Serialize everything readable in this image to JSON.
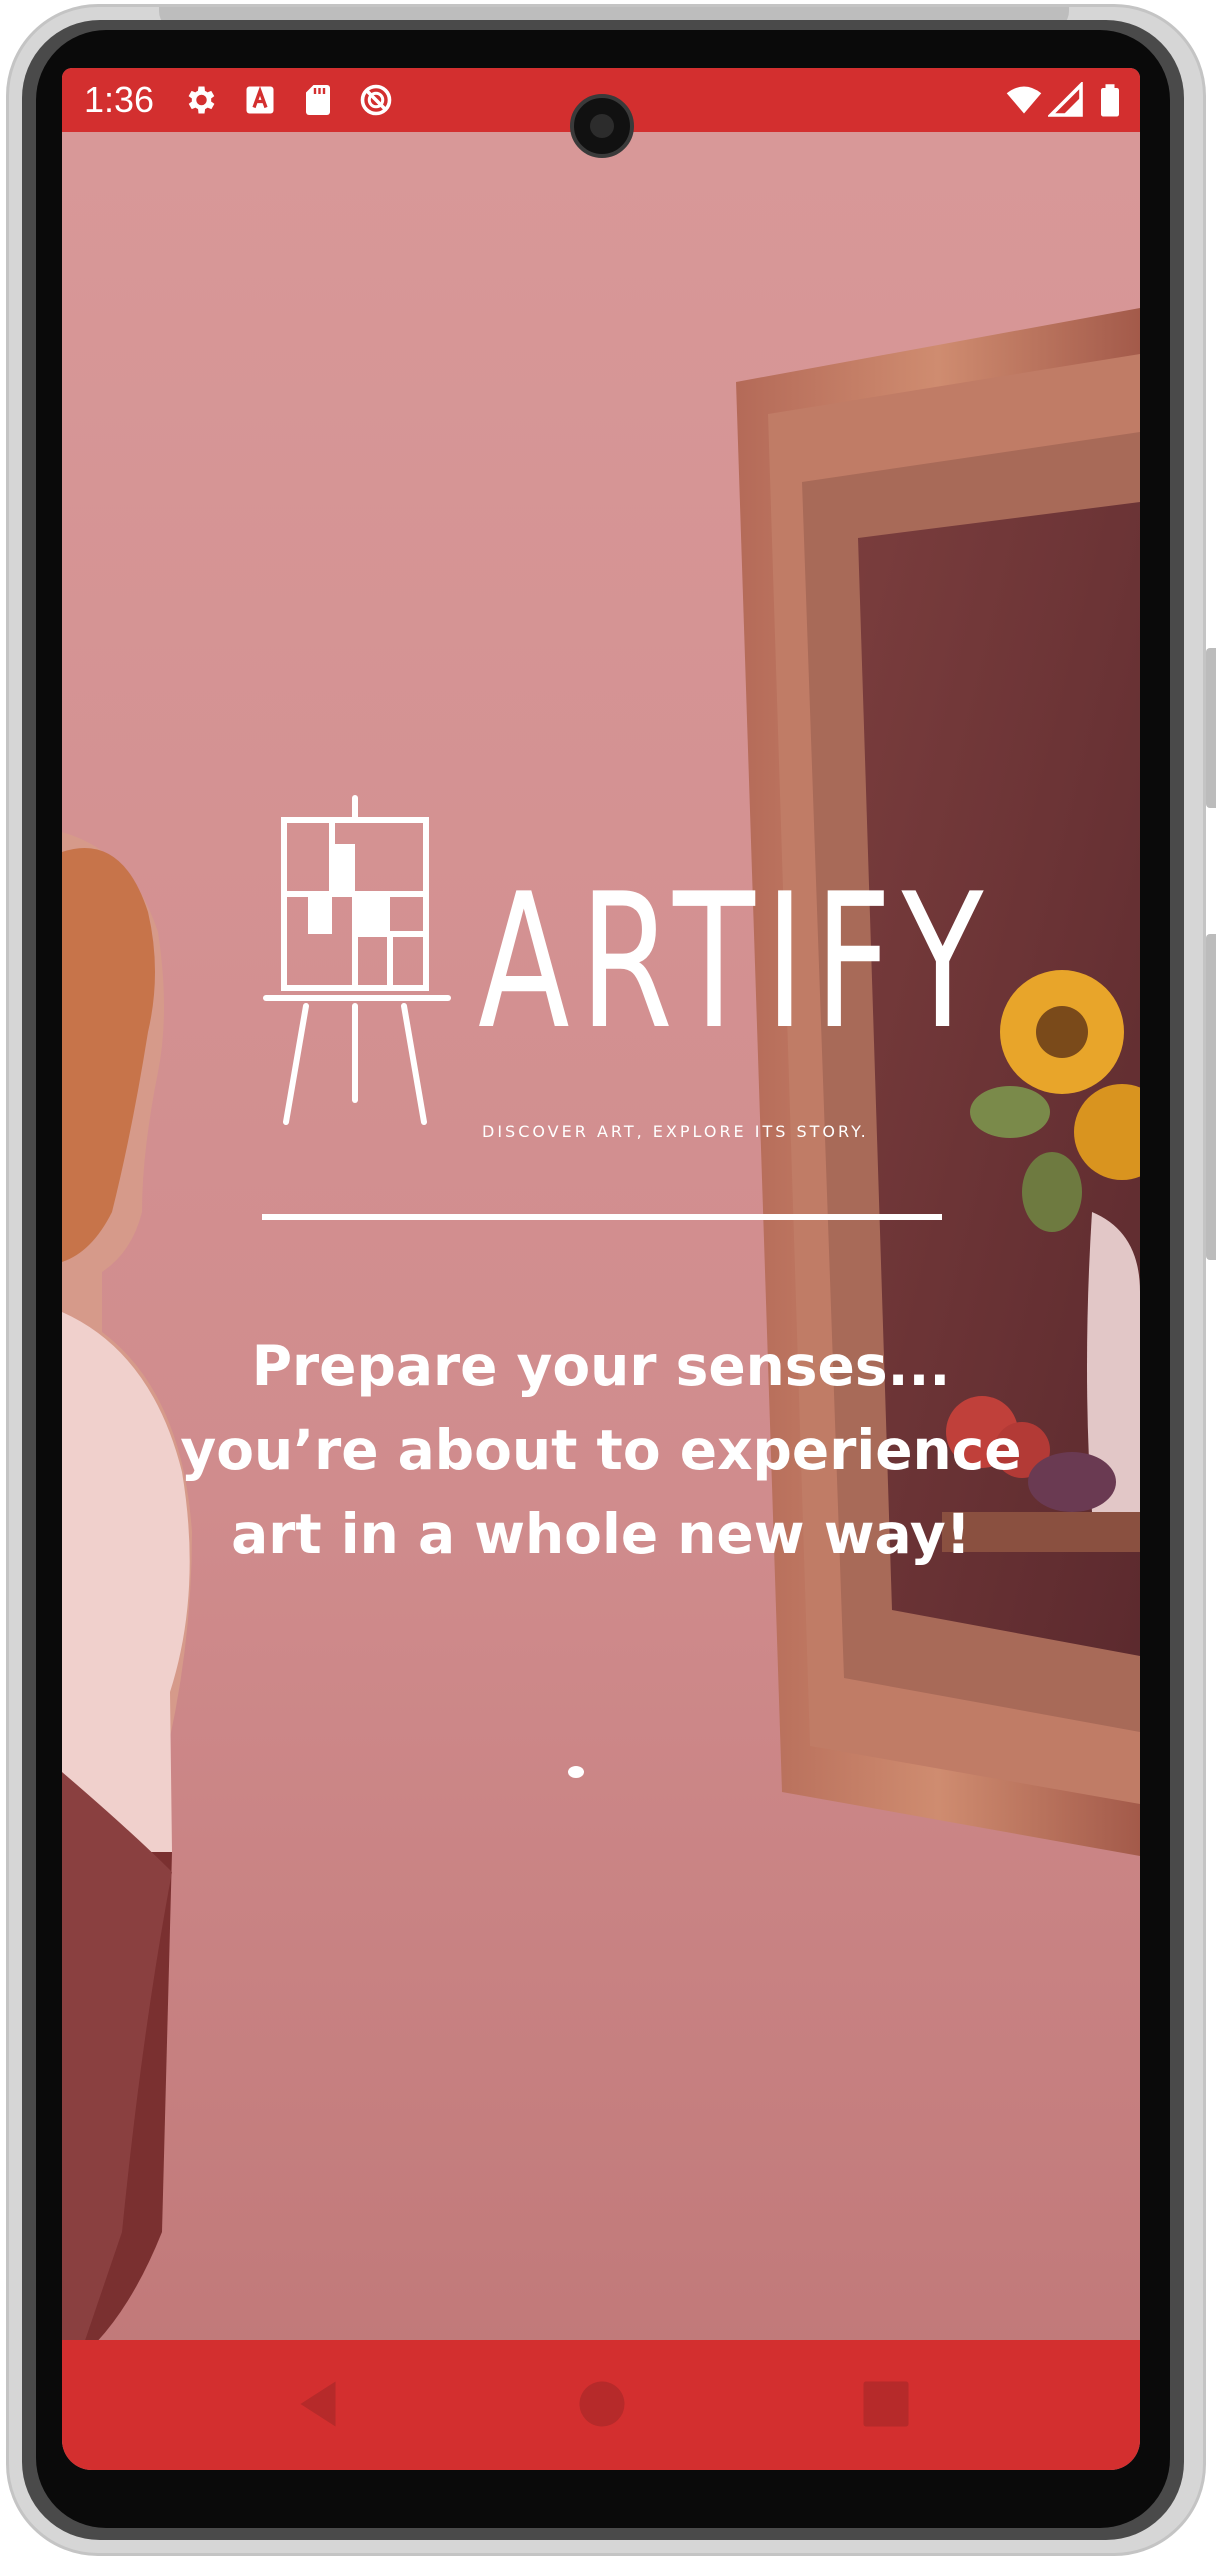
{
  "status_bar": {
    "time": "1:36",
    "left_icons": [
      "gear-icon",
      "a-letter-icon",
      "sd-card-icon",
      "do-not-disturb-icon"
    ],
    "right_icons": [
      "wifi-icon",
      "cell-signal-icon",
      "battery-icon"
    ],
    "background_color": "#d32f2f"
  },
  "splash": {
    "brand_name": "ARTIFY",
    "tagline": "DISCOVER ART, EXPLORE ITS STORY.",
    "headline_lines": [
      "Prepare your senses...",
      "you’re about to experience",
      "art in a whole new way!"
    ],
    "overlay_color": "#d32f2f",
    "text_color": "#ffffff",
    "background_image": "woman viewing a framed sunflower still-life painting in a gallery",
    "loading": true
  },
  "nav_bar": {
    "buttons": [
      "back-icon",
      "home-icon",
      "recents-icon"
    ],
    "background_color": "#d32f2f"
  }
}
